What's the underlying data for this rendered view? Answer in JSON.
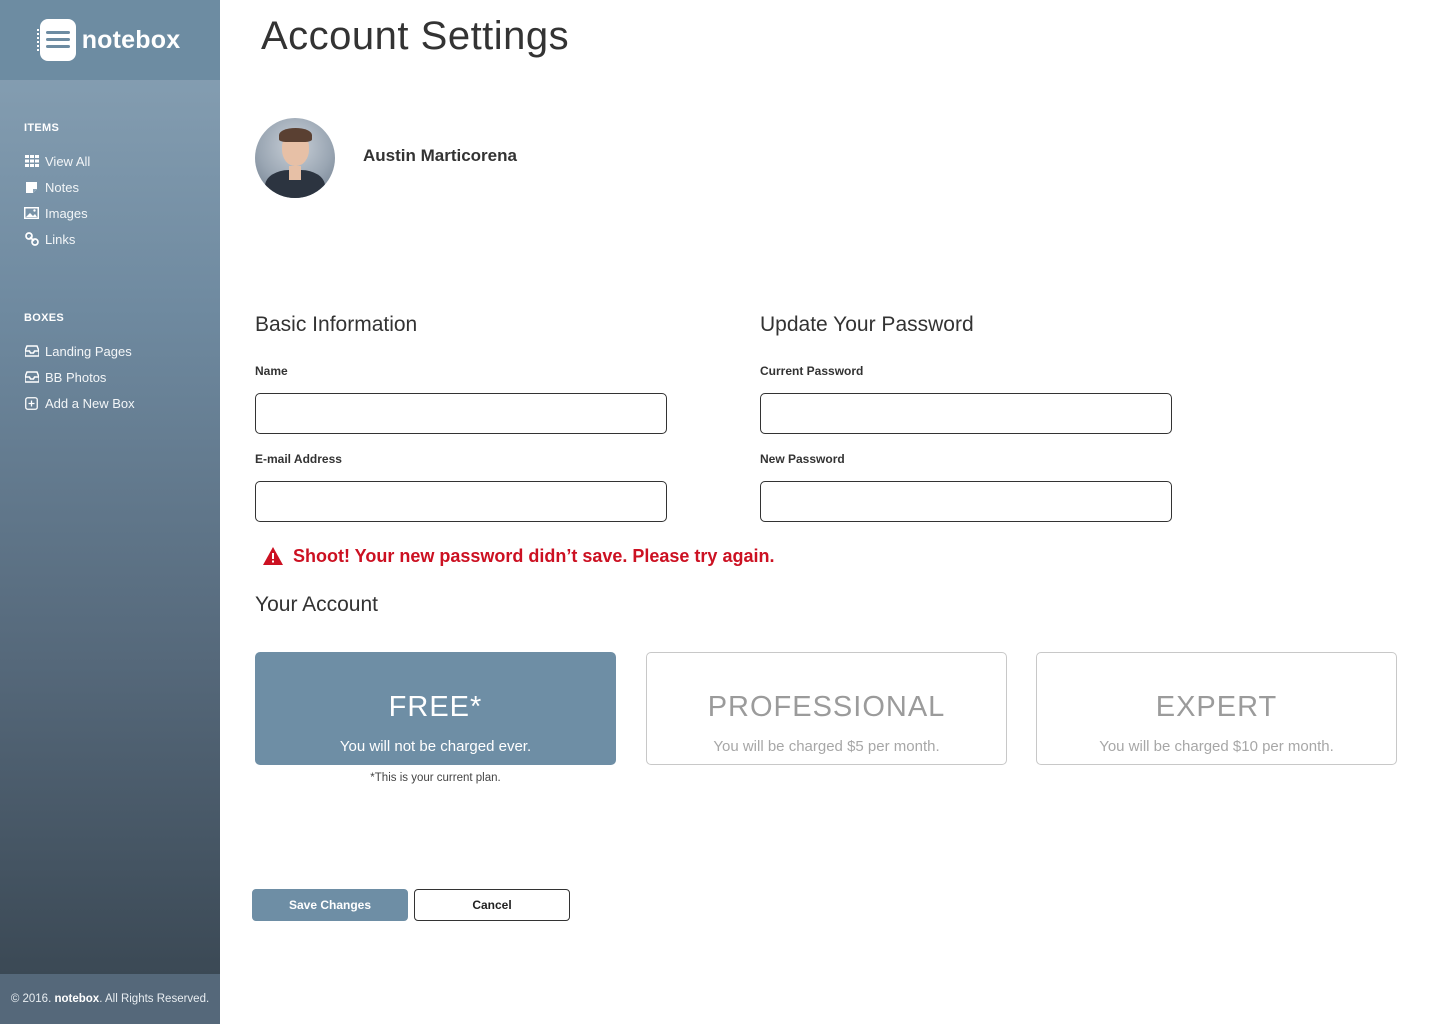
{
  "brand": {
    "name": "notebox",
    "logo_icon": "notebook-icon"
  },
  "sidebar": {
    "items_heading": "ITEMS",
    "items": [
      {
        "label": "View All",
        "icon": "grid-icon"
      },
      {
        "label": "Notes",
        "icon": "note-icon"
      },
      {
        "label": "Images",
        "icon": "image-icon"
      },
      {
        "label": "Links",
        "icon": "link-icon"
      }
    ],
    "boxes_heading": "BOXES",
    "boxes": [
      {
        "label": "Landing Pages",
        "icon": "inbox-icon"
      },
      {
        "label": "BB Photos",
        "icon": "inbox-icon"
      },
      {
        "label": "Add a New Box",
        "icon": "plus-square-icon"
      }
    ],
    "footer": {
      "prefix": "© 2016.",
      "brand": "notebox",
      "suffix": ". All Rights Reserved."
    }
  },
  "page": {
    "title": "Account Settings"
  },
  "user": {
    "name": "Austin Marticorena"
  },
  "basic_info": {
    "title": "Basic Information",
    "name_label": "Name",
    "name_value": "",
    "email_label": "E-mail Address",
    "email_value": ""
  },
  "password": {
    "title": "Update Your Password",
    "current_label": "Current Password",
    "current_value": "",
    "new_label": "New Password",
    "new_value": ""
  },
  "error": {
    "message": "Shoot! Your new password didn’t save. Please try again.",
    "icon": "warning-icon",
    "color": "#cc1122"
  },
  "account": {
    "title": "Your Account",
    "plans": [
      {
        "name": "FREE*",
        "description": "You will not be charged ever.",
        "selected": true
      },
      {
        "name": "PROFESSIONAL",
        "description": "You will be charged $5 per month.",
        "selected": false
      },
      {
        "name": "EXPERT",
        "description": "You will be charged $10 per month.",
        "selected": false
      }
    ],
    "note": "*This is your current plan."
  },
  "actions": {
    "save_label": "Save Changes",
    "cancel_label": "Cancel"
  },
  "colors": {
    "accent": "#6e8ea5",
    "sidebar_top": "#8aa3b6",
    "sidebar_bottom": "#37444f",
    "error": "#cc1122"
  }
}
